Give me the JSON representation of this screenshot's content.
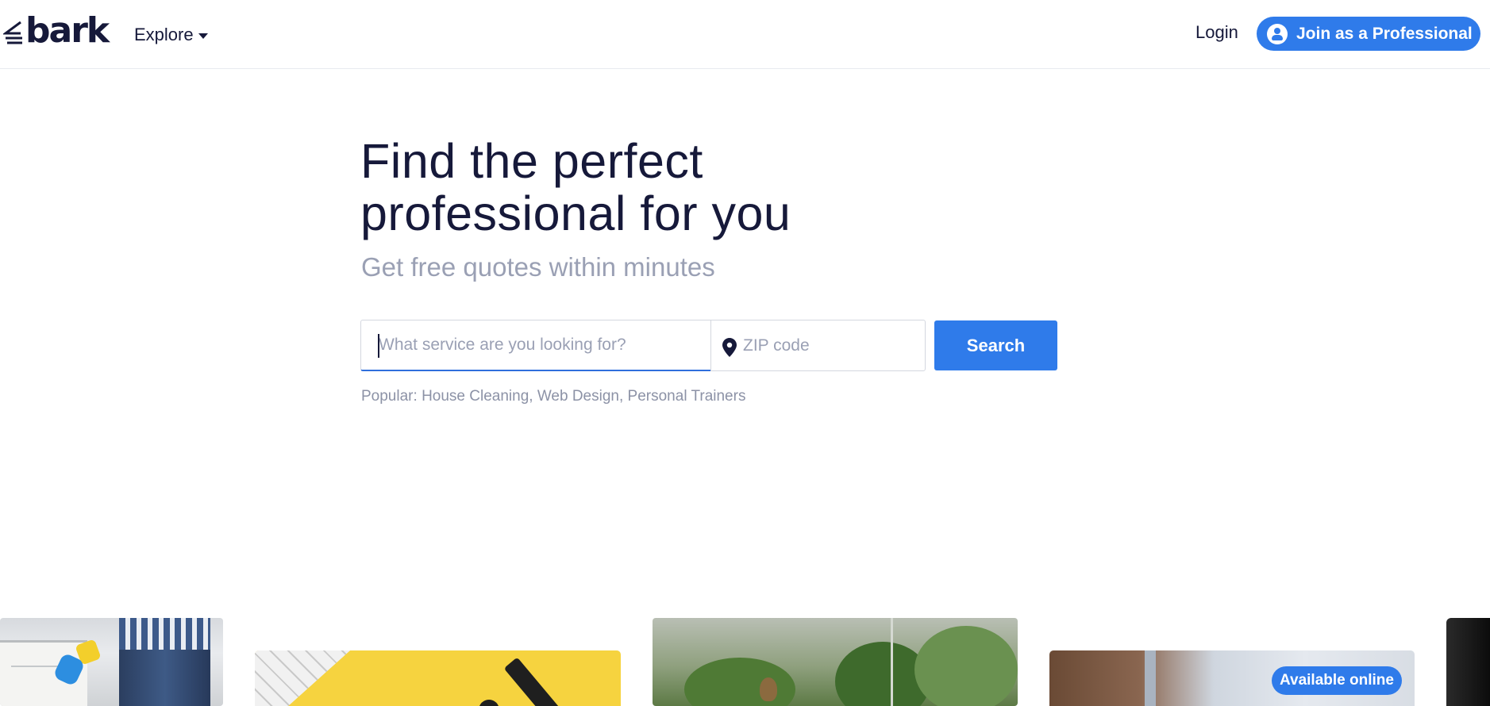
{
  "header": {
    "logo_text": "bark",
    "explore_label": "Explore",
    "login_label": "Login",
    "join_label": "Join as a Professional"
  },
  "hero": {
    "title_line1": "Find the perfect",
    "title_line2": "professional for you",
    "subtitle": "Get free quotes within minutes"
  },
  "search": {
    "service_placeholder": "What service are you looking for?",
    "service_value": "",
    "zip_placeholder": "ZIP code",
    "zip_value": "",
    "button_label": "Search"
  },
  "popular": {
    "prefix": "Popular:",
    "items": [
      "House Cleaning",
      "Web Design",
      "Personal Trainers"
    ]
  },
  "cards": {
    "badge": "Available online"
  },
  "colors": {
    "brand_blue": "#2f7bea",
    "text_dark": "#16193a",
    "text_muted": "#9aa0b4"
  },
  "icons": {
    "explore": "chevron-down-icon",
    "join": "user-icon",
    "zip": "map-pin-icon"
  }
}
